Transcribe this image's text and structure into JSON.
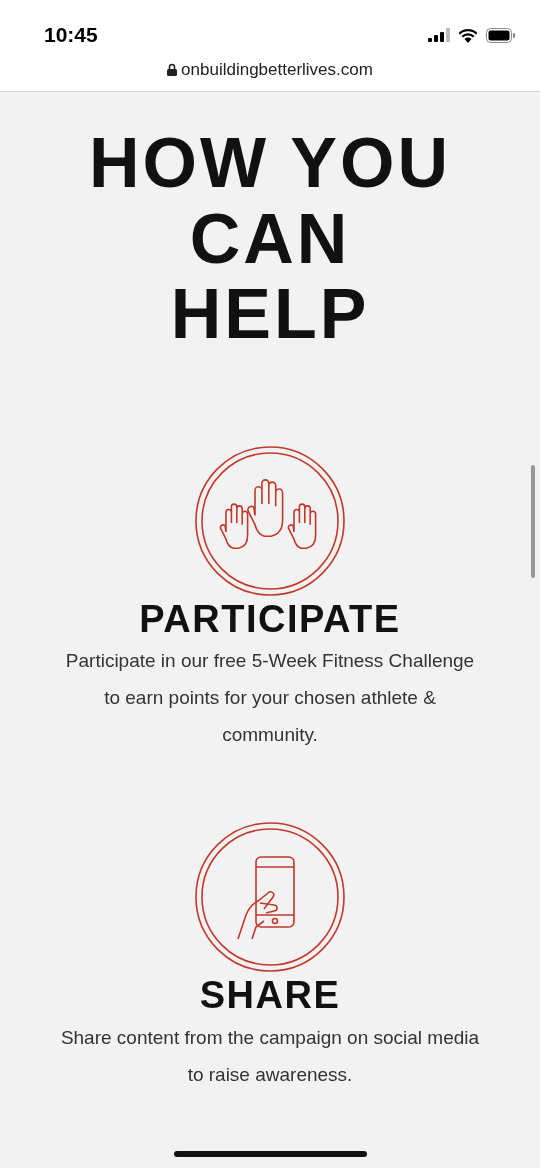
{
  "status_bar": {
    "time": "10:45"
  },
  "address_bar": {
    "url": "onbuildingbetterlives.com"
  },
  "heading": "HOW YOU CAN HELP",
  "items": [
    {
      "kind": "hands",
      "title": "PARTICIPATE",
      "description": "Participate in our free 5-Week Fitness Challenge to earn points for your chosen athlete & community."
    },
    {
      "kind": "phone",
      "title": "SHARE",
      "description": "Share content from the campaign on social media to raise awareness."
    }
  ]
}
